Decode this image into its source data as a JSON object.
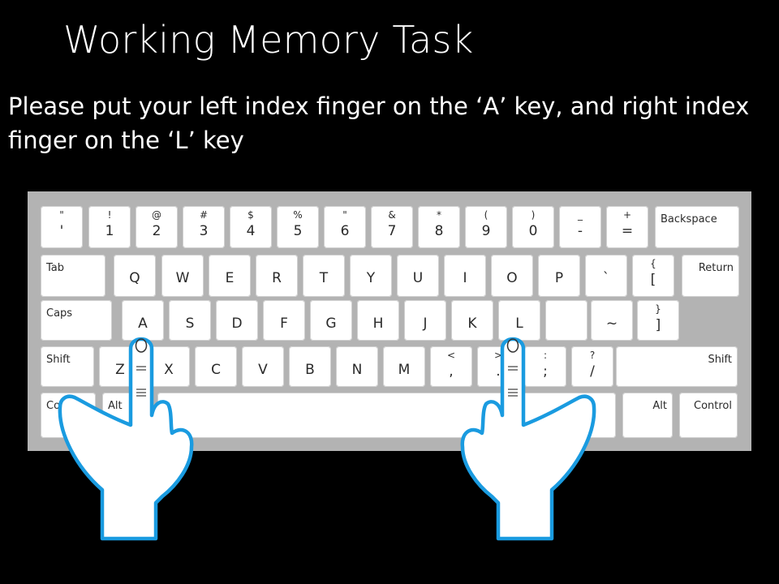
{
  "slide": {
    "title": "Working Memory Task",
    "instruction": "Please put your left index finger on the ‘A’ key, and right index finger on the ‘L’ key"
  },
  "keyboard": {
    "rows": [
      [
        {
          "top": "\"",
          "bot": "'"
        },
        {
          "top": "!",
          "bot": "1"
        },
        {
          "top": "@",
          "bot": "2"
        },
        {
          "top": "#",
          "bot": "3"
        },
        {
          "top": "$",
          "bot": "4"
        },
        {
          "top": "%",
          "bot": "5"
        },
        {
          "top": "\"",
          "bot": "6"
        },
        {
          "top": "&",
          "bot": "7"
        },
        {
          "top": "*",
          "bot": "8"
        },
        {
          "top": "(",
          "bot": "9"
        },
        {
          "top": ")",
          "bot": "0"
        },
        {
          "top": "_",
          "bot": "-"
        },
        {
          "top": "+",
          "bot": "="
        },
        {
          "label": "Backspace"
        }
      ],
      [
        {
          "label": "Tab"
        },
        {
          "main": "Q"
        },
        {
          "main": "W"
        },
        {
          "main": "E"
        },
        {
          "main": "R"
        },
        {
          "main": "T"
        },
        {
          "main": "Y"
        },
        {
          "main": "U"
        },
        {
          "main": "I"
        },
        {
          "main": "O"
        },
        {
          "main": "P"
        },
        {
          "main": "`"
        },
        {
          "top": "{",
          "bot": "["
        },
        {
          "label": "Return"
        }
      ],
      [
        {
          "label": "Caps"
        },
        {
          "main": "A"
        },
        {
          "main": "S"
        },
        {
          "main": "D"
        },
        {
          "main": "F"
        },
        {
          "main": "G"
        },
        {
          "main": "H"
        },
        {
          "main": "J"
        },
        {
          "main": "K"
        },
        {
          "main": "L"
        },
        {
          "main": ""
        },
        {
          "main": "~"
        },
        {
          "top": "}",
          "bot": "]"
        }
      ],
      [
        {
          "label": "Shift"
        },
        {
          "main": "Z"
        },
        {
          "main": "X"
        },
        {
          "main": "C"
        },
        {
          "main": "V"
        },
        {
          "main": "B"
        },
        {
          "main": "N"
        },
        {
          "main": "M"
        },
        {
          "top": "<",
          "bot": ","
        },
        {
          "top": ">",
          "bot": "."
        },
        {
          "top": ":",
          "bot": ";"
        },
        {
          "top": "?",
          "bot": "/"
        },
        {
          "label": "Shift"
        }
      ],
      [
        {
          "label": "Control"
        },
        {
          "label": "Alt"
        },
        {
          "label": ""
        },
        {
          "label": "Alt"
        },
        {
          "label": "Control"
        }
      ]
    ]
  },
  "colors": {
    "background": "#000000",
    "text": "#ffffff",
    "keyboard_frame": "#b3b3b3",
    "hand_outline": "#1a9be0"
  },
  "icons": {
    "left_hand": "pointing-hand-icon",
    "right_hand": "pointing-hand-icon"
  }
}
